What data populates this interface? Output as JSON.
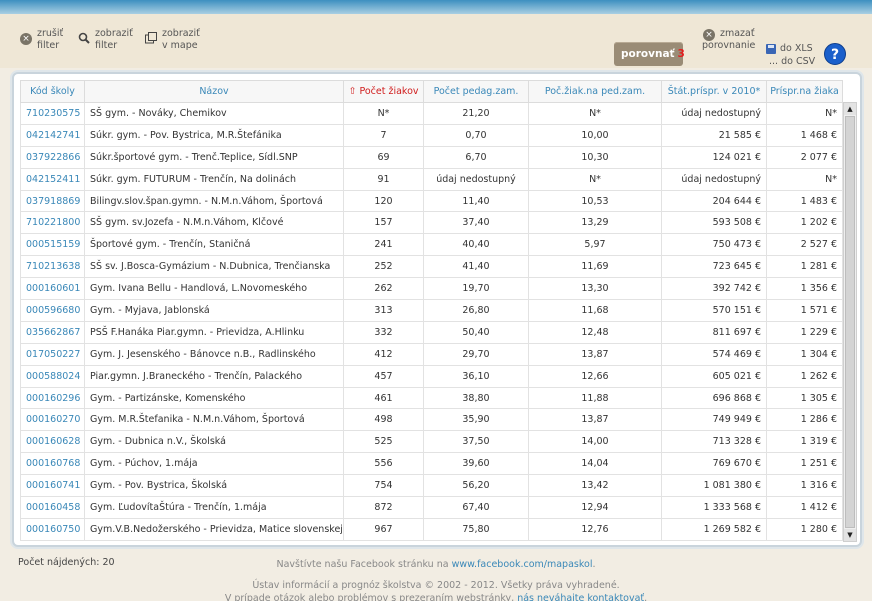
{
  "toolbar": {
    "clear_filter": [
      "zrušiť",
      "filter"
    ],
    "show_filter": [
      "zobraziť",
      "filter"
    ],
    "show_map": [
      "zobraziť",
      "v mape"
    ],
    "compare_label": "porovnať",
    "compare_count": "3",
    "clear_compare": [
      "zmazať",
      "porovnanie"
    ],
    "export_xls": "do XLS",
    "export_csv": "... do CSV",
    "help": "?"
  },
  "table": {
    "headers": [
      "Kód školy",
      "Názov",
      "Počet žiakov",
      "Počet pedag.zam.",
      "Poč.žiak.na ped.zam.",
      "Štát.príspr. v 2010*",
      "Príspr.na žiaka"
    ],
    "sort_icon": "sort-asc-icon",
    "rows": [
      [
        "710230575",
        "SŠ gym. - Nováky, Chemikov",
        "N*",
        "21,20",
        "N*",
        "údaj nedostupný",
        "N*"
      ],
      [
        "042142741",
        "Súkr. gym. - Pov. Bystrica, M.R.Štefánika",
        "7",
        "0,70",
        "10,00",
        "21 585 €",
        "1 468 €"
      ],
      [
        "037922866",
        "Súkr.športové gym. - Trenč.Teplice, Sídl.SNP",
        "69",
        "6,70",
        "10,30",
        "124 021 €",
        "2 077 €"
      ],
      [
        "042152411",
        "Súkr. gym. FUTURUM - Trenčín, Na dolinách",
        "91",
        "údaj nedostupný",
        "N*",
        "údaj nedostupný",
        "N*"
      ],
      [
        "037918869",
        "Bilingv.slov.špan.gymn. - N.M.n.Váhom, Športová",
        "120",
        "11,40",
        "10,53",
        "204 644 €",
        "1 483 €"
      ],
      [
        "710221800",
        "SŠ gym. sv.Jozefa - N.M.n.Váhom, Klčové",
        "157",
        "37,40",
        "13,29",
        "593 508 €",
        "1 202 €"
      ],
      [
        "000515159",
        "Športové gym. - Trenčín, Staničná",
        "241",
        "40,40",
        "5,97",
        "750 473 €",
        "2 527 €"
      ],
      [
        "710213638",
        "SŠ sv. J.Bosca-Gymázium - N.Dubnica, Trenčianska",
        "252",
        "41,40",
        "11,69",
        "723 645 €",
        "1 281 €"
      ],
      [
        "000160601",
        "Gym. Ivana Bellu - Handlová, L.Novomeského",
        "262",
        "19,70",
        "13,30",
        "392 742 €",
        "1 356 €"
      ],
      [
        "000596680",
        "Gym. - Myjava, Jablonská",
        "313",
        "26,80",
        "11,68",
        "570 151 €",
        "1 571 €"
      ],
      [
        "035662867",
        "PSŠ F.Hanáka Piar.gymn. - Prievidza, A.Hlinku",
        "332",
        "50,40",
        "12,48",
        "811 697 €",
        "1 229 €"
      ],
      [
        "017050227",
        "Gym. J. Jesenského - Bánovce n.B., Radlinského",
        "412",
        "29,70",
        "13,87",
        "574 469 €",
        "1 304 €"
      ],
      [
        "000588024",
        "Piar.gymn. J.Braneckého - Trenčín, Palackého",
        "457",
        "36,10",
        "12,66",
        "605 021 €",
        "1 262 €"
      ],
      [
        "000160296",
        "Gym. - Partizánske, Komenského",
        "461",
        "38,80",
        "11,88",
        "696 868 €",
        "1 305 €"
      ],
      [
        "000160270",
        "Gym. M.R.Štefanika - N.M.n.Váhom, Športová",
        "498",
        "35,90",
        "13,87",
        "749 949 €",
        "1 286 €"
      ],
      [
        "000160628",
        "Gym. - Dubnica n.V., Školská",
        "525",
        "37,50",
        "14,00",
        "713 328 €",
        "1 319 €"
      ],
      [
        "000160768",
        "Gym. - Púchov, 1.mája",
        "556",
        "39,60",
        "14,04",
        "769 670 €",
        "1 251 €"
      ],
      [
        "000160741",
        "Gym. - Pov. Bystrica, Školská",
        "754",
        "56,20",
        "13,42",
        "1 081 380 €",
        "1 316 €"
      ],
      [
        "000160458",
        "Gym. ĽudovítaŠtúra - Trenčín, 1.mája",
        "872",
        "67,40",
        "12,94",
        "1 333 568 €",
        "1 412 €"
      ],
      [
        "000160750",
        "Gym.V.B.Nedožerského - Prievidza, Matice slovenskej",
        "967",
        "75,80",
        "12,76",
        "1 269 582 €",
        "1 280 €"
      ]
    ]
  },
  "footer": {
    "count": "Počet nájdených: 20",
    "fb_text": "Navštívte našu Facebook stránku na",
    "fb_link": "www.facebook.com/mapaskol",
    "fb_end": ".",
    "copyright": "Ústav informácií a prognóz školstva © 2002 - 2012. Všetky práva vyhradené.",
    "contact_text": "V prípade otázok alebo problémov s prezeraním webstránky,",
    "contact_link": "nás neváhajte kontaktovať",
    "contact_end": "."
  }
}
